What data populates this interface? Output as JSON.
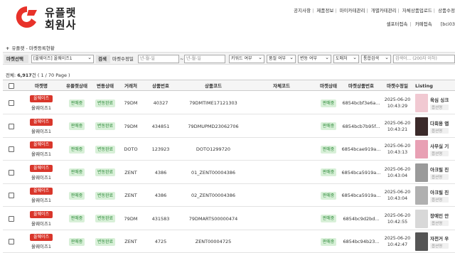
{
  "brand": {
    "line1": "유플랫",
    "line2": "회원사",
    "color": "#e8322a"
  },
  "topnav": [
    "공지사항",
    "제품정보",
    "마이카테관리",
    "개별카테관리",
    "자체상품업로드",
    "상품수정"
  ],
  "subnav": {
    "links": [
      "셀포터접속",
      "카페접속"
    ],
    "user": "[bci03"
  },
  "breadcrumb": {
    "icon": "+",
    "text": "유플랫 - 마켓등록현황"
  },
  "filters": {
    "market_label": "마켓선택",
    "market_value": "[올웨이즈] 올웨이즈1",
    "search_label": "검색",
    "date_type": "마켓수정일",
    "date_from": "년-월-일",
    "tilde": "~",
    "date_to": "년-월-일",
    "keyword_type": "키워드 여부",
    "pumjeol": "품절 여부",
    "change": "변동 여부",
    "domain": "도매처",
    "search_type": "통합검색",
    "search_placeholder": "검색어... (200자 이하)"
  },
  "total": {
    "prefix": "전체:",
    "count": "6,917",
    "suffix": "건 ( 1 / 70 Page )"
  },
  "columns": {
    "market": "마켓명",
    "uplat_status": "유플랫상태",
    "change_status": "변동상태",
    "vendor": "거래처",
    "product_no": "상품번호",
    "product_code": "상품코드",
    "own_code": "자체코드",
    "market_status": "마켓상태",
    "market_product_no": "마켓상품번호",
    "modified": "마켓수정일",
    "listing": "Listing"
  },
  "rows": [
    {
      "market_badge": "올웨이즈",
      "market_name": "올웨이즈1",
      "uplat_status": "판매중",
      "change_status": "변동완료",
      "vendor": "79DM",
      "product_no": "40327",
      "product_code": "79DMTIME17121303",
      "own_code": "",
      "market_status": "판매중",
      "market_product_no": "6854bcbf3e6a...",
      "modified_date": "2025-06-20",
      "modified_time": "10:43:29",
      "listing_title": "육심 싱크",
      "listing_opt": "옵션명",
      "thumb": "#f1c9d2"
    },
    {
      "market_badge": "올웨이즈",
      "market_name": "올웨이즈1",
      "uplat_status": "판매중",
      "change_status": "변동완료",
      "vendor": "79DM",
      "product_no": "434851",
      "product_code": "79DMUPMD23062706",
      "own_code": "",
      "market_status": "판매중",
      "market_product_no": "6854bcb7b95f...",
      "modified_date": "2025-06-20",
      "modified_time": "10:43:21",
      "listing_title": "다회용 앱",
      "listing_opt": "옵션명",
      "thumb": "#3b2a2a"
    },
    {
      "market_badge": "올웨이즈",
      "market_name": "올웨이즈1",
      "uplat_status": "판매중",
      "change_status": "변동완료",
      "vendor": "DOTO",
      "product_no": "123923",
      "product_code": "DOTO1299720",
      "own_code": "",
      "market_status": "판매중",
      "market_product_no": "6854bcae919a...",
      "modified_date": "2025-06-20",
      "modified_time": "10:43:13",
      "listing_title": "사무실 기",
      "listing_opt": "옵션명",
      "thumb": "#e8a0b4"
    },
    {
      "market_badge": "올웨이즈",
      "market_name": "올웨이즈1",
      "uplat_status": "판매중",
      "change_status": "변동완료",
      "vendor": "ZENT",
      "product_no": "4386",
      "product_code": "01_ZENT00004386",
      "own_code": "",
      "market_status": "판매중",
      "market_product_no": "6854bca5919a...",
      "modified_date": "2025-06-20",
      "modified_time": "10:43:04",
      "listing_title": "아크릴 진",
      "listing_opt": "옵션명",
      "thumb": "#9a9a9a"
    },
    {
      "market_badge": "올웨이즈",
      "market_name": "올웨이즈1",
      "uplat_status": "판매중",
      "change_status": "변동완료",
      "vendor": "ZENT",
      "product_no": "4386",
      "product_code": "02_ZENT00004386",
      "own_code": "",
      "market_status": "판매중",
      "market_product_no": "6854bca5919a...",
      "modified_date": "2025-06-20",
      "modified_time": "10:43:04",
      "listing_title": "아크릴 진",
      "listing_opt": "옵션명",
      "thumb": "#b0b0b0"
    },
    {
      "market_badge": "올웨이즈",
      "market_name": "올웨이즈1",
      "uplat_status": "판매중",
      "change_status": "변동완료",
      "vendor": "79DM",
      "product_no": "431583",
      "product_code": "79DMARTS00000474",
      "own_code": "",
      "market_status": "판매중",
      "market_product_no": "6854bc9d2bd...",
      "modified_date": "2025-06-20",
      "modified_time": "10:42:55",
      "listing_title": "장애인 안",
      "listing_opt": "옵션명",
      "thumb": "#d8d8d8"
    },
    {
      "market_badge": "올웨이즈",
      "market_name": "올웨이즈1",
      "uplat_status": "판매중",
      "change_status": "변동완료",
      "vendor": "ZENT",
      "product_no": "4725",
      "product_code": "ZENT00004725",
      "own_code": "",
      "market_status": "판매중",
      "market_product_no": "6854bc94b23...",
      "modified_date": "2025-06-20",
      "modified_time": "10:42:47",
      "listing_title": "자전거 우",
      "listing_opt": "옵션명",
      "thumb": "#555555"
    }
  ]
}
